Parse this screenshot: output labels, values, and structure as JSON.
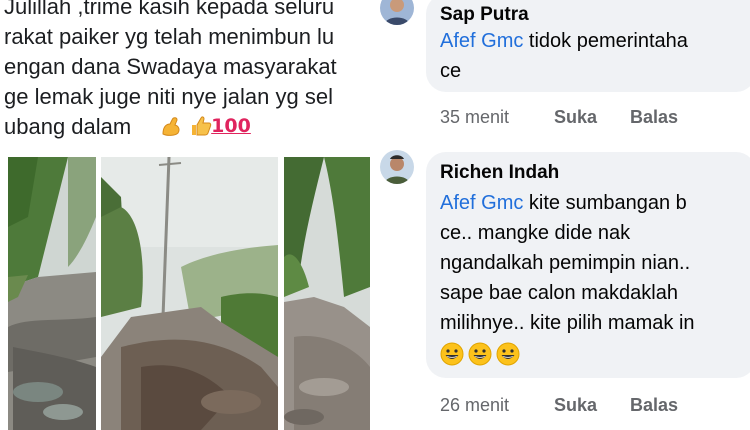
{
  "post": {
    "lines": [
      "Julillah ,trime kasih kepada seluru",
      "rakat paiker yg telah menimbun lu",
      "engan dana Swadaya masyarakat",
      "ge lemak juge niti nye jalan yg sel",
      "ubang dalam"
    ],
    "emojis": [
      "flexed-biceps",
      "thumbs-up",
      "hundred-points"
    ],
    "hundred_text": "100",
    "photos": [
      "muddy-road-left",
      "muddy-road-center",
      "muddy-road-right"
    ]
  },
  "comments": [
    {
      "author": "Sap Putra",
      "mention": "Afef Gmc",
      "text_lines": [
        " tidok pemerintaha",
        "ce"
      ],
      "time": "35 menit",
      "like": "Suka",
      "reply": "Balas"
    },
    {
      "author": "Richen Indah",
      "mention": "Afef Gmc",
      "text_lines": [
        " kite sumbangan b",
        "ce.. mangke dide nak",
        "ngandalkah pemimpin nian..",
        "sape bae calon makdaklah",
        "milihnye.. kite pilih mamak in"
      ],
      "emoji_line": [
        "grinning-face",
        "grinning-face",
        "grinning-face"
      ],
      "time": "26 menit",
      "like": "Suka",
      "reply": "Balas"
    }
  ],
  "colors": {
    "mention": "#216fdb",
    "bubble": "#f0f2f5",
    "meta_text": "#65676b",
    "text": "#050505"
  }
}
